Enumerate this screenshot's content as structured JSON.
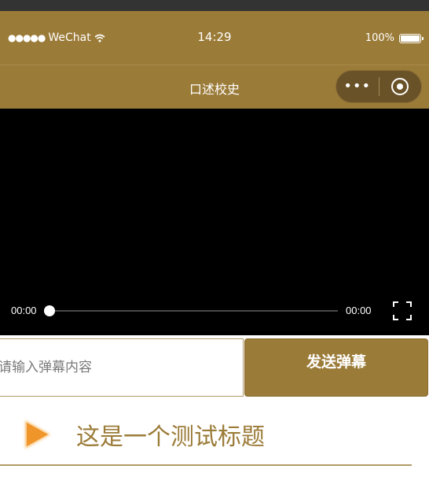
{
  "status_bar": {
    "signal_dots": "●●●●●",
    "carrier": "WeChat",
    "time": "14:29",
    "battery_percent": "100%",
    "battery_level": 1.0
  },
  "navbar": {
    "title": "口述校史",
    "more_label": "•••",
    "bg_color": "#9b7b38"
  },
  "video": {
    "current_time": "00:00",
    "duration": "00:00",
    "progress": 0
  },
  "danmu": {
    "placeholder": "请输入弹幕内容",
    "send_label": "发送弹幕"
  },
  "list": {
    "items": [
      {
        "title": "这是一个测试标题",
        "icon": "play-triangle-icon"
      }
    ]
  },
  "colors": {
    "brand": "#9b7b38",
    "play_icon": "#f0952a"
  }
}
